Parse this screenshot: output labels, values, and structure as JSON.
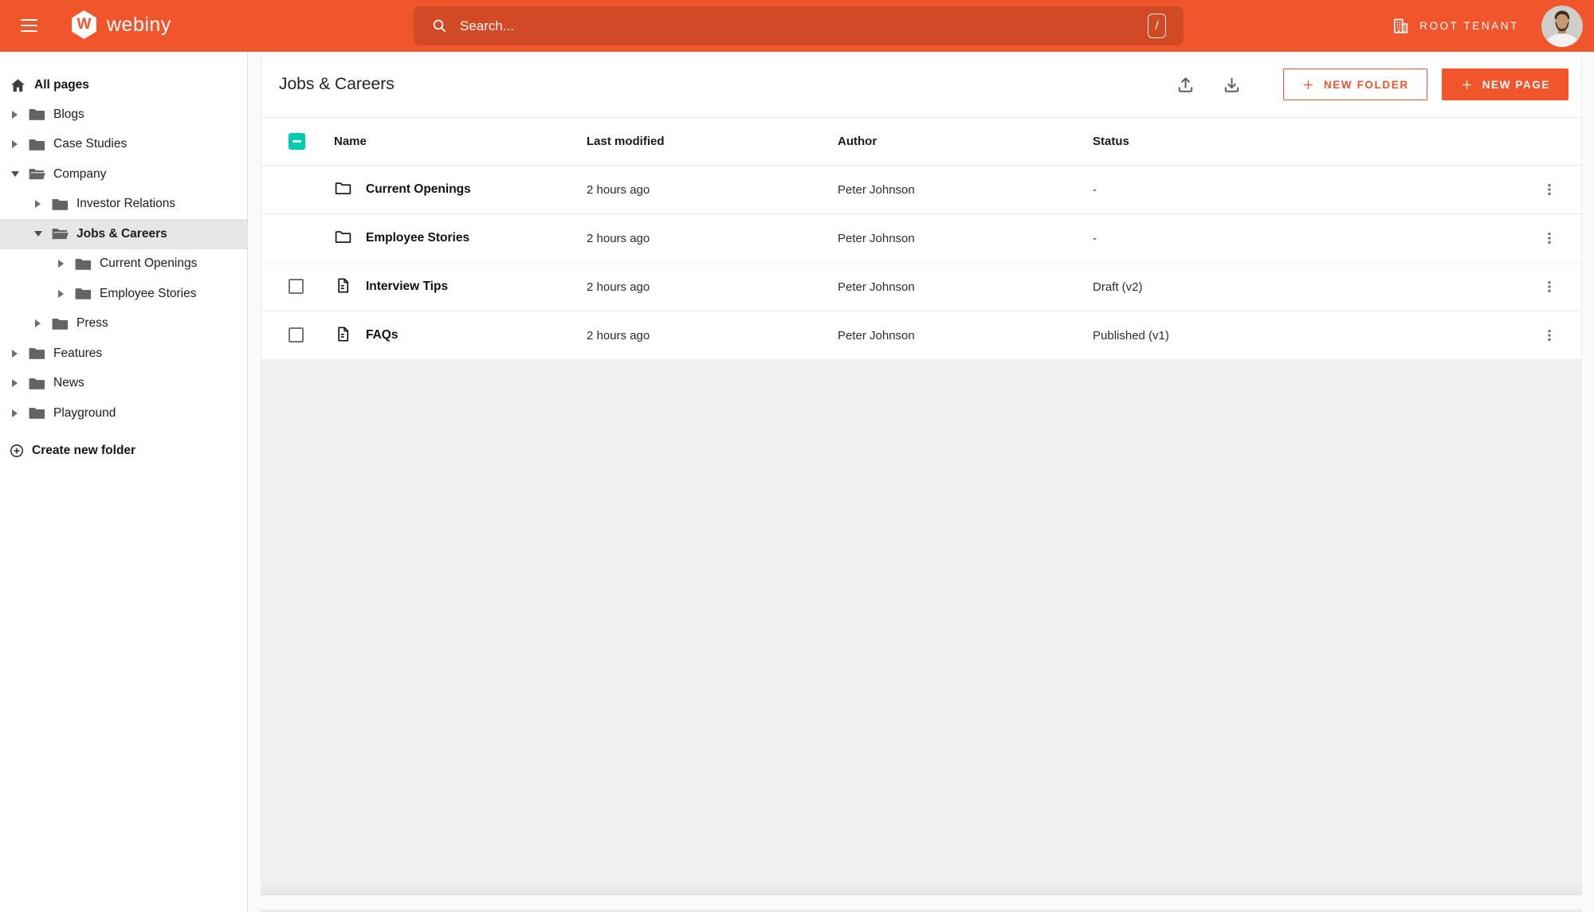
{
  "colors": {
    "primary": "#f0552b",
    "select_all_teal": "#00ccb0"
  },
  "topbar": {
    "brand": "webiny",
    "logo_letter": "W",
    "search": {
      "placeholder": "Search...",
      "shortcut_key": "/"
    },
    "tenant_label": "ROOT TENANT"
  },
  "sidebar": {
    "home_label": "All pages",
    "items": [
      {
        "label": "Blogs",
        "level": 1,
        "expanded": false,
        "selected": false
      },
      {
        "label": "Case Studies",
        "level": 1,
        "expanded": false,
        "selected": false
      },
      {
        "label": "Company",
        "level": 1,
        "expanded": true,
        "selected": false
      },
      {
        "label": "Investor Relations",
        "level": 2,
        "expanded": false,
        "selected": false
      },
      {
        "label": "Jobs & Careers",
        "level": 2,
        "expanded": true,
        "selected": true
      },
      {
        "label": "Current Openings",
        "level": 3,
        "expanded": false,
        "selected": false
      },
      {
        "label": "Employee Stories",
        "level": 3,
        "expanded": false,
        "selected": false
      },
      {
        "label": "Press",
        "level": 2,
        "expanded": false,
        "selected": false
      },
      {
        "label": "Features",
        "level": 1,
        "expanded": false,
        "selected": false
      },
      {
        "label": "News",
        "level": 1,
        "expanded": false,
        "selected": false
      },
      {
        "label": "Playground",
        "level": 1,
        "expanded": false,
        "selected": false
      }
    ],
    "create_folder_label": "Create new folder"
  },
  "main": {
    "title": "Jobs & Careers",
    "actions": {
      "new_folder": "NEW FOLDER",
      "new_page": "NEW PAGE"
    },
    "table": {
      "columns": {
        "name": "Name",
        "modified": "Last modified",
        "author": "Author",
        "status": "Status"
      },
      "rows": [
        {
          "type": "folder",
          "name": "Current Openings",
          "modified": "2 hours ago",
          "author": "Peter Johnson",
          "status": "-"
        },
        {
          "type": "folder",
          "name": "Employee Stories",
          "modified": "2 hours ago",
          "author": "Peter Johnson",
          "status": "-"
        },
        {
          "type": "page",
          "name": "Interview Tips",
          "modified": "2 hours ago",
          "author": "Peter Johnson",
          "status": "Draft (v2)"
        },
        {
          "type": "page",
          "name": "FAQs",
          "modified": "2 hours ago",
          "author": "Peter Johnson",
          "status": "Published (v1)"
        }
      ]
    }
  }
}
